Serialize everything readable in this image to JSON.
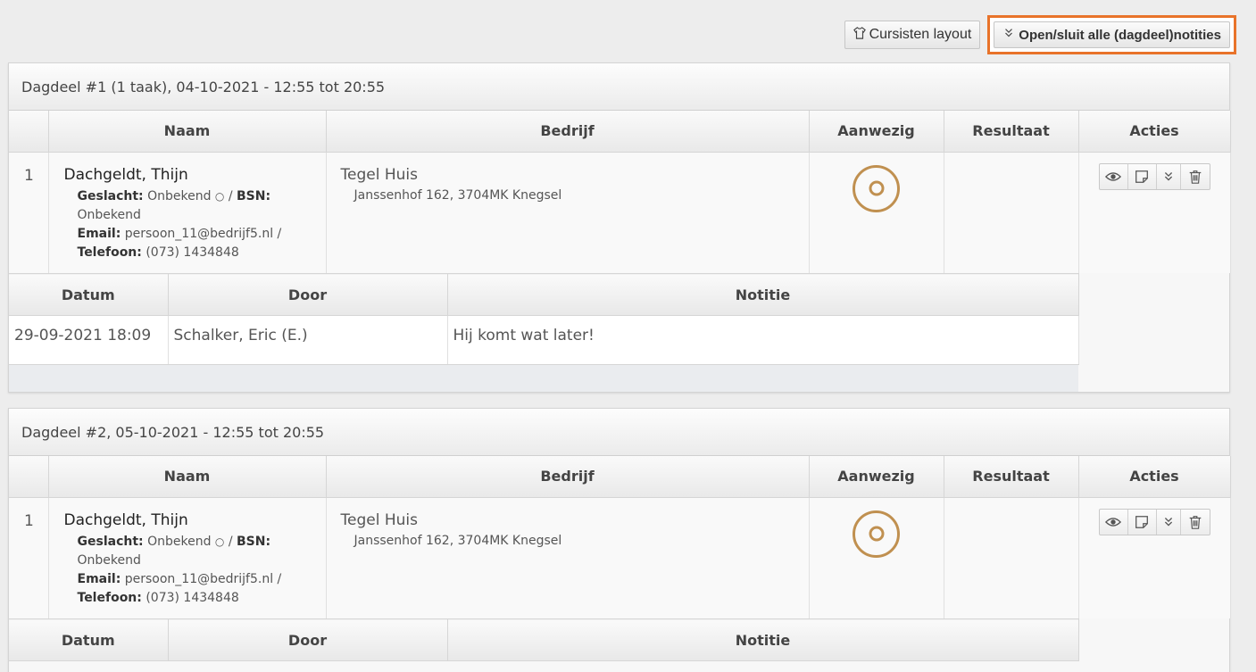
{
  "toolbar": {
    "layout_button": "Cursisten layout",
    "toggle_notes_button": "Open/sluit alle (dagdeel)notities"
  },
  "columns": {
    "naam": "Naam",
    "bedrijf": "Bedrijf",
    "aanwezig": "Aanwezig",
    "resultaat": "Resultaat",
    "acties": "Acties"
  },
  "note_columns": {
    "datum": "Datum",
    "door": "Door",
    "notitie": "Notitie"
  },
  "labels": {
    "geslacht": "Geslacht:",
    "bsn": "BSN:",
    "email": "Email:",
    "telefoon": "Telefoon:"
  },
  "dagdelen": [
    {
      "title": "Dagdeel #1 (1 taak), 04-10-2021 - 12:55 tot 20:55",
      "row": {
        "num": "1",
        "name": "Dachgeldt, Thijn",
        "geslacht": "Onbekend",
        "bsn": "Onbekend",
        "email": "persoon_11@bedrijf5.nl",
        "telefoon": "(073) 1434848",
        "company": "Tegel Huis",
        "address": "Janssenhof 162, 3704MK Knegsel"
      },
      "notes": [
        {
          "datum": "29-09-2021 18:09",
          "door": "Schalker, Eric (E.)",
          "notitie": "Hij komt wat later!"
        }
      ]
    },
    {
      "title": "Dagdeel #2, 05-10-2021 - 12:55 tot 20:55",
      "row": {
        "num": "1",
        "name": "Dachgeldt, Thijn",
        "geslacht": "Onbekend",
        "bsn": "Onbekend",
        "email": "persoon_11@bedrijf5.nl",
        "telefoon": "(073) 1434848",
        "company": "Tegel Huis",
        "address": "Janssenhof 162, 3704MK Knegsel"
      }
    }
  ],
  "colors": {
    "highlight": "#e8732a",
    "presence_ring": "#c09050"
  }
}
